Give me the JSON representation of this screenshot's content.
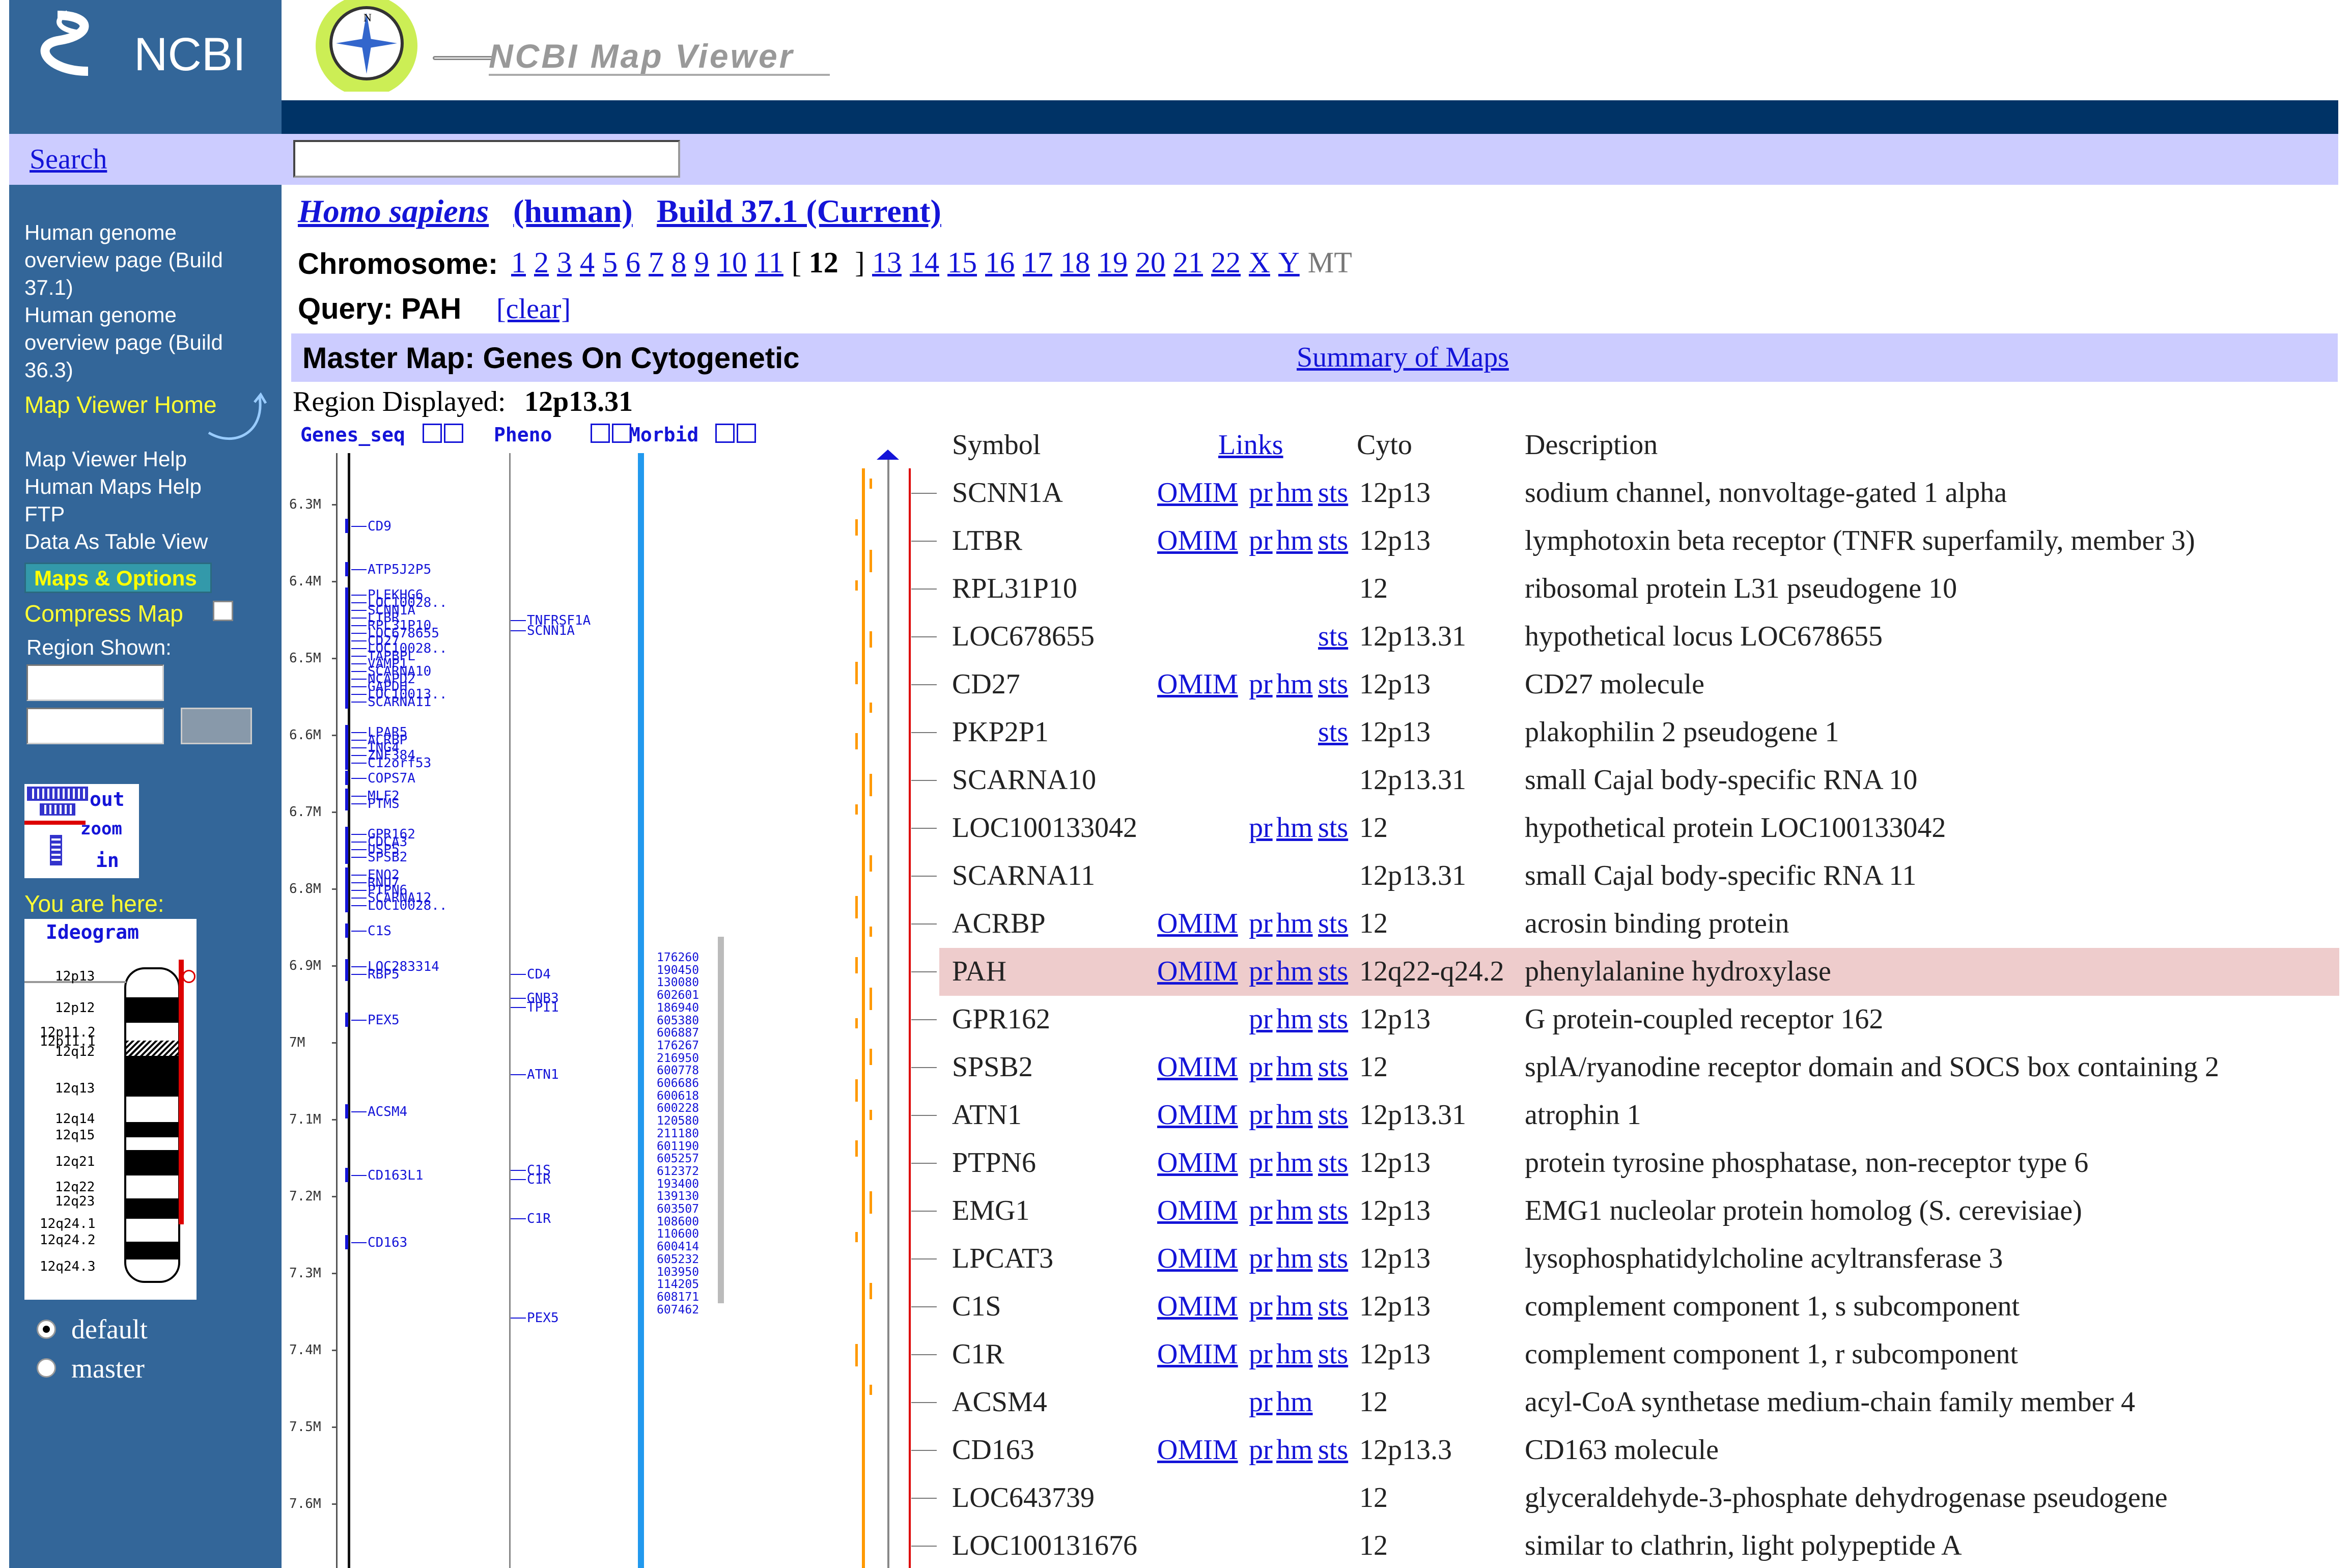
{
  "header": {
    "org": "NCBI",
    "app_title": "NCBI Map Viewer"
  },
  "search": {
    "label": "Search",
    "value": ""
  },
  "sidebar": {
    "links": [
      "Human genome overview page (Build 37.1)",
      "Human genome overview page (Build 36.3)"
    ],
    "home": "Map Viewer Home",
    "help_links": [
      "Map Viewer Help",
      "Human Maps Help",
      "FTP",
      "Data As Table View"
    ],
    "maps_options": "Maps & Options",
    "compress": "Compress Map",
    "region_shown": "Region Shown:",
    "zoom": {
      "out": "out",
      "zoom": "zoom",
      "in": "in"
    },
    "you_are_here": "You are here:",
    "ideogram_title": "Ideogram",
    "ideogram_bands": [
      "12p13",
      "12p12",
      "12p11.2",
      "12p11.1",
      "12q12",
      "12q13",
      "12q14",
      "12q15",
      "12q21",
      "12q22",
      "12q23",
      "12q24.1",
      "12q24.2",
      "12q24.3"
    ],
    "radio_default": "default",
    "radio_master": "master"
  },
  "organism": {
    "species": "Homo sapiens",
    "common": "(human)",
    "build": "Build 37.1 (Current)"
  },
  "chromosome": {
    "label": "Chromosome:",
    "items": [
      "1",
      "2",
      "3",
      "4",
      "5",
      "6",
      "7",
      "8",
      "9",
      "10",
      "11",
      "12",
      "13",
      "14",
      "15",
      "16",
      "17",
      "18",
      "19",
      "20",
      "21",
      "22",
      "X",
      "Y",
      "MT"
    ],
    "current": "12"
  },
  "query": {
    "label": "Query: PAH",
    "clear": "[clear]"
  },
  "master_map": {
    "title": "Master Map: Genes On Cytogenetic",
    "summary": "Summary of Maps"
  },
  "region": {
    "label": "Region Displayed:",
    "value": "12p13.31"
  },
  "map_tracks": {
    "headers": [
      "Genes_seq",
      "Pheno",
      "Morbid"
    ],
    "scale": [
      "6.3M",
      "6.4M",
      "6.5M",
      "6.6M",
      "6.7M",
      "6.8M",
      "6.9M",
      "7M",
      "7.1M",
      "7.2M",
      "7.3M",
      "7.4M",
      "7.5M",
      "7.6M"
    ],
    "genes": [
      "CD9",
      "ATP5J2P5",
      "PLEKHG6",
      "LOC10028..",
      "SCNN1A",
      "LTBR",
      "RPL31P10",
      "LOC678655",
      "CD27",
      "LOC10028..",
      "TAPBPL",
      "VAMP1",
      "SCARNA10",
      "NCAPD2",
      "GAPDH",
      "LOC10013..",
      "SCARNA11",
      "LPAR5",
      "ACRBP",
      "ING4",
      "ZNF384",
      "C12orf53",
      "COPS7A",
      "MLF2",
      "PTMS",
      "GPR162",
      "CDCA3",
      "USP5",
      "SPSB2",
      "ENO2",
      "RNU7",
      "PTPN6",
      "SCARNA12",
      "LOC10028..",
      "C1S",
      "LOC283314",
      "RBP5",
      "PEX5",
      "ACSM4",
      "CD163L1",
      "CD163"
    ],
    "pheno": [
      "TNFRSF1A",
      "SCNN1A",
      "CD4",
      "GNB3",
      "TPI1",
      "ATN1",
      "C1S",
      "C1R",
      "C1R",
      "PEX5"
    ],
    "morbid": [
      "176260",
      "190450",
      "130080",
      "602601",
      "186940",
      "605380",
      "606887",
      "176267",
      "216950",
      "600778",
      "606686",
      "600618",
      "600228",
      "120580",
      "211180",
      "601190",
      "605257",
      "612372",
      "193400",
      "139130",
      "603507",
      "108600",
      "110600",
      "600414",
      "605232",
      "103950",
      "114205",
      "608171",
      "607462"
    ]
  },
  "table": {
    "headers": {
      "symbol": "Symbol",
      "links": "Links",
      "cyto": "Cyto",
      "desc": "Description"
    },
    "rows": [
      {
        "symbol": "SCNN1A",
        "omim": "OMIM",
        "pr": "pr",
        "hm": "hm",
        "sts": "sts",
        "cyto": "12p13",
        "desc": "sodium channel, nonvoltage-gated 1 alpha"
      },
      {
        "symbol": "LTBR",
        "omim": "OMIM",
        "pr": "pr",
        "hm": "hm",
        "sts": "sts",
        "cyto": "12p13",
        "desc": "lymphotoxin beta receptor (TNFR superfamily, member 3)"
      },
      {
        "symbol": "RPL31P10",
        "omim": "",
        "pr": "",
        "hm": "",
        "sts": "",
        "cyto": "12",
        "desc": "ribosomal protein L31 pseudogene 10"
      },
      {
        "symbol": "LOC678655",
        "omim": "",
        "pr": "",
        "hm": "",
        "sts": "sts",
        "cyto": "12p13.31",
        "desc": "hypothetical locus LOC678655"
      },
      {
        "symbol": "CD27",
        "omim": "OMIM",
        "pr": "pr",
        "hm": "hm",
        "sts": "sts",
        "cyto": "12p13",
        "desc": "CD27 molecule"
      },
      {
        "symbol": "PKP2P1",
        "omim": "",
        "pr": "",
        "hm": "",
        "sts": "sts",
        "cyto": "12p13",
        "desc": "plakophilin 2 pseudogene 1"
      },
      {
        "symbol": "SCARNA10",
        "omim": "",
        "pr": "",
        "hm": "",
        "sts": "",
        "cyto": "12p13.31",
        "desc": "small Cajal body-specific RNA 10"
      },
      {
        "symbol": "LOC100133042",
        "omim": "",
        "pr": "pr",
        "hm": "hm",
        "sts": "sts",
        "cyto": "12",
        "desc": "hypothetical protein LOC100133042"
      },
      {
        "symbol": "SCARNA11",
        "omim": "",
        "pr": "",
        "hm": "",
        "sts": "",
        "cyto": "12p13.31",
        "desc": "small Cajal body-specific RNA 11"
      },
      {
        "symbol": "ACRBP",
        "omim": "OMIM",
        "pr": "pr",
        "hm": "hm",
        "sts": "sts",
        "cyto": "12",
        "desc": "acrosin binding protein"
      },
      {
        "symbol": "PAH",
        "omim": "OMIM",
        "pr": "pr",
        "hm": "hm",
        "sts": "sts",
        "cyto": "12q22-q24.2",
        "desc": "phenylalanine hydroxylase",
        "highlight": true
      },
      {
        "symbol": "GPR162",
        "omim": "",
        "pr": "pr",
        "hm": "hm",
        "sts": "sts",
        "cyto": "12p13",
        "desc": "G protein-coupled receptor 162"
      },
      {
        "symbol": "SPSB2",
        "omim": "OMIM",
        "pr": "pr",
        "hm": "hm",
        "sts": "sts",
        "cyto": "12",
        "desc": "splA/ryanodine receptor domain and SOCS box containing 2"
      },
      {
        "symbol": "ATN1",
        "omim": "OMIM",
        "pr": "pr",
        "hm": "hm",
        "sts": "sts",
        "cyto": "12p13.31",
        "desc": "atrophin 1"
      },
      {
        "symbol": "PTPN6",
        "omim": "OMIM",
        "pr": "pr",
        "hm": "hm",
        "sts": "sts",
        "cyto": "12p13",
        "desc": "protein tyrosine phosphatase, non-receptor type 6"
      },
      {
        "symbol": "EMG1",
        "omim": "OMIM",
        "pr": "pr",
        "hm": "hm",
        "sts": "sts",
        "cyto": "12p13",
        "desc": "EMG1 nucleolar protein homolog (S. cerevisiae)"
      },
      {
        "symbol": "LPCAT3",
        "omim": "OMIM",
        "pr": "pr",
        "hm": "hm",
        "sts": "sts",
        "cyto": "12p13",
        "desc": "lysophosphatidylcholine acyltransferase 3"
      },
      {
        "symbol": "C1S",
        "omim": "OMIM",
        "pr": "pr",
        "hm": "hm",
        "sts": "sts",
        "cyto": "12p13",
        "desc": "complement component 1, s subcomponent"
      },
      {
        "symbol": "C1R",
        "omim": "OMIM",
        "pr": "pr",
        "hm": "hm",
        "sts": "sts",
        "cyto": "12p13",
        "desc": "complement component 1, r subcomponent"
      },
      {
        "symbol": "ACSM4",
        "omim": "",
        "pr": "pr",
        "hm": "hm",
        "sts": "",
        "cyto": "12",
        "desc": "acyl-CoA synthetase medium-chain family member 4"
      },
      {
        "symbol": "CD163",
        "omim": "OMIM",
        "pr": "pr",
        "hm": "hm",
        "sts": "sts",
        "cyto": "12p13.3",
        "desc": "CD163 molecule"
      },
      {
        "symbol": "LOC643739",
        "omim": "",
        "pr": "",
        "hm": "",
        "sts": "",
        "cyto": "12",
        "desc": "glyceraldehyde-3-phosphate dehydrogenase pseudogene"
      },
      {
        "symbol": "LOC100131676",
        "omim": "",
        "pr": "",
        "hm": "",
        "sts": "",
        "cyto": "12",
        "desc": "similar to clathrin, light polypeptide A"
      }
    ]
  },
  "colors": {
    "sidebar": "#336699",
    "topbar": "#003366",
    "bar": "#ccccff",
    "link": "#1414d8",
    "highlight": "#eecccc",
    "orange": "#ff9900",
    "red": "#dd0000"
  }
}
